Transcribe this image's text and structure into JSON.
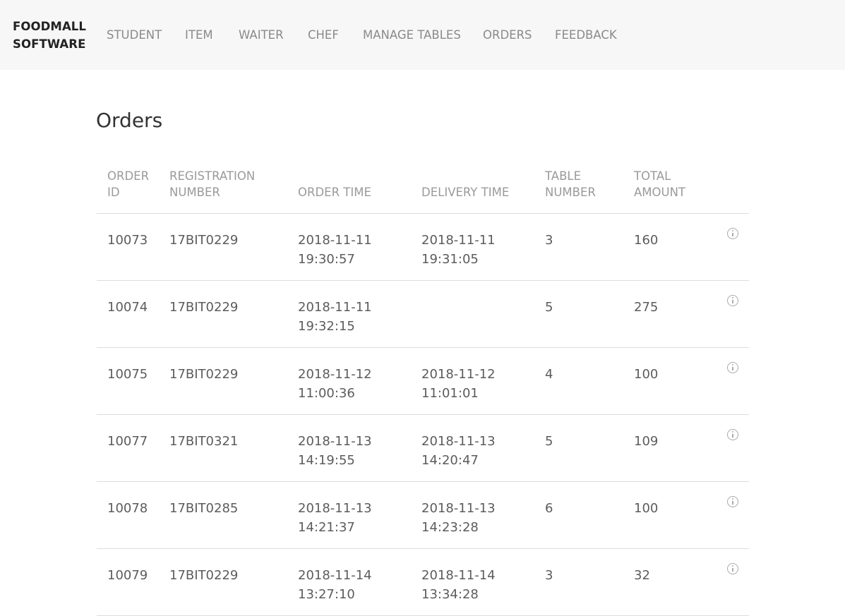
{
  "navbar": {
    "brand_line1": "FOODMALL",
    "brand_line2": "SOFTWARE",
    "links": [
      "STUDENT",
      "ITEM",
      "WAITER",
      "CHEF",
      "MANAGE TABLES",
      "ORDERS",
      "FEEDBACK"
    ]
  },
  "page": {
    "title": "Orders"
  },
  "table": {
    "headers": {
      "order_id": [
        "ORDER",
        "ID"
      ],
      "registration_number": [
        "REGISTRATION",
        "NUMBER"
      ],
      "order_time": "ORDER TIME",
      "delivery_time": "DELIVERY TIME",
      "table_number": [
        "TABLE",
        "NUMBER"
      ],
      "total_amount": [
        "TOTAL",
        "AMOUNT"
      ]
    },
    "rows": [
      {
        "order_id": "10073",
        "reg": "17BIT0229",
        "order_date": "2018-11-11",
        "order_clock": "19:30:57",
        "delivery_date": "2018-11-11",
        "delivery_clock": "19:31:05",
        "table": "3",
        "total": "160"
      },
      {
        "order_id": "10074",
        "reg": "17BIT0229",
        "order_date": "2018-11-11",
        "order_clock": "19:32:15",
        "delivery_date": "",
        "delivery_clock": "",
        "table": "5",
        "total": "275"
      },
      {
        "order_id": "10075",
        "reg": "17BIT0229",
        "order_date": "2018-11-12",
        "order_clock": "11:00:36",
        "delivery_date": "2018-11-12",
        "delivery_clock": "11:01:01",
        "table": "4",
        "total": "100"
      },
      {
        "order_id": "10077",
        "reg": "17BIT0321",
        "order_date": "2018-11-13",
        "order_clock": "14:19:55",
        "delivery_date": "2018-11-13",
        "delivery_clock": "14:20:47",
        "table": "5",
        "total": "109"
      },
      {
        "order_id": "10078",
        "reg": "17BIT0285",
        "order_date": "2018-11-13",
        "order_clock": "14:21:37",
        "delivery_date": "2018-11-13",
        "delivery_clock": "14:23:28",
        "table": "6",
        "total": "100"
      },
      {
        "order_id": "10079",
        "reg": "17BIT0229",
        "order_date": "2018-11-14",
        "order_clock": "13:27:10",
        "delivery_date": "2018-11-14",
        "delivery_clock": "13:34:28",
        "table": "3",
        "total": "32"
      }
    ],
    "row_icon": "info-icon"
  }
}
